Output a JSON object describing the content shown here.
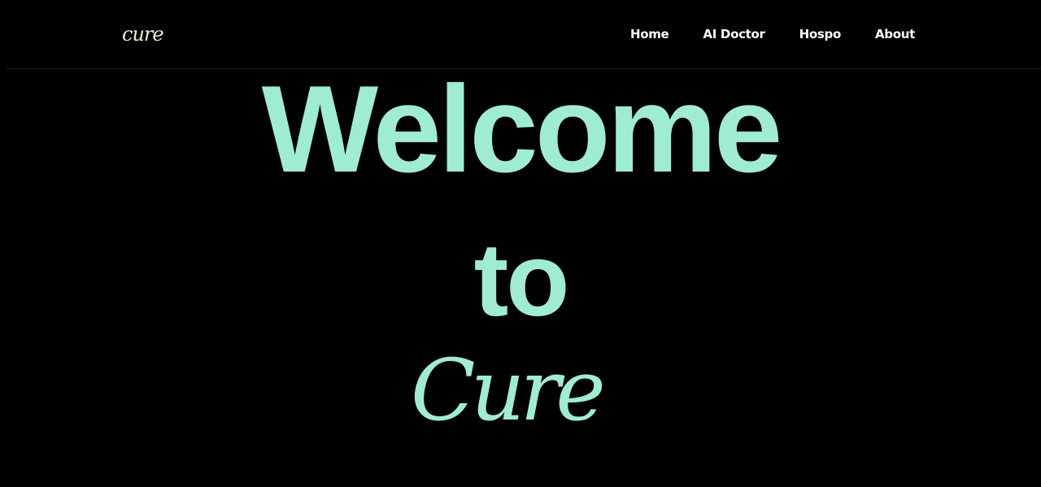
{
  "navbar": {
    "logo": "cure",
    "links": [
      {
        "label": "Home"
      },
      {
        "label": "AI Doctor"
      },
      {
        "label": "Hospo"
      },
      {
        "label": "About"
      }
    ]
  },
  "hero": {
    "line1": "Welcome",
    "line2": "to",
    "brand": "Cure"
  },
  "colors": {
    "background": "#000000",
    "accent": "#a0ecd2",
    "logo": "#f3ecd6",
    "nav_text": "#ffffff"
  }
}
